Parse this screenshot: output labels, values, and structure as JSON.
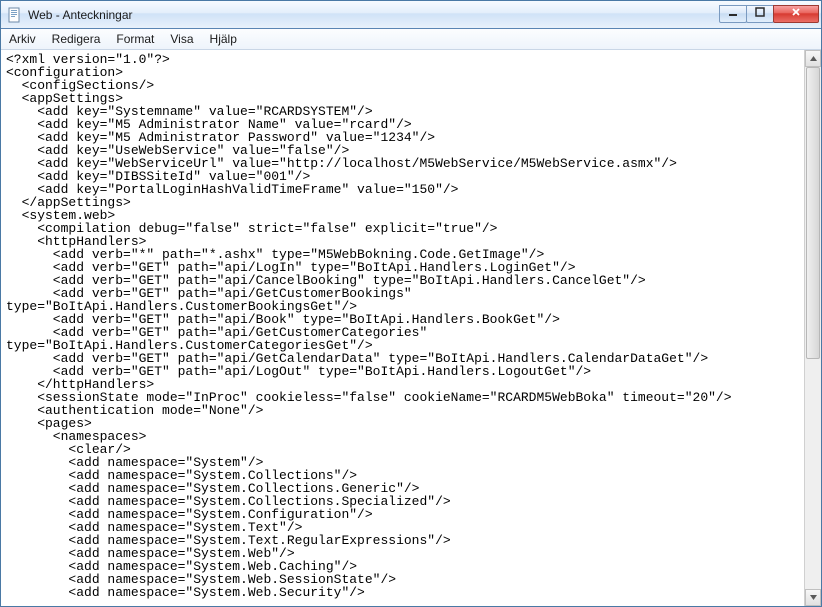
{
  "window": {
    "title": "Web - Anteckningar"
  },
  "menu": {
    "items": [
      "Arkiv",
      "Redigera",
      "Format",
      "Visa",
      "Hjälp"
    ]
  },
  "icons": {
    "app": "notepad-icon",
    "minimize": "minimize-icon",
    "maximize": "maximize-icon",
    "close": "close-icon",
    "scroll_up": "scroll-up-icon",
    "scroll_down": "scroll-down-icon"
  },
  "controls": {
    "minimize": "Minimize",
    "maximize": "Maximize",
    "close": "Close"
  },
  "editor": {
    "content": "<?xml version=\"1.0\"?>\n<configuration>\n  <configSections/>\n  <appSettings>\n    <add key=\"Systemname\" value=\"RCARDSYSTEM\"/>\n    <add key=\"M5 Administrator Name\" value=\"rcard\"/>\n    <add key=\"M5 Administrator Password\" value=\"1234\"/>\n    <add key=\"UseWebService\" value=\"false\"/>\n    <add key=\"WebServiceUrl\" value=\"http://localhost/M5WebService/M5WebService.asmx\"/>\n    <add key=\"DIBSSiteId\" value=\"001\"/>\n    <add key=\"PortalLoginHashValidTimeFrame\" value=\"150\"/>\n  </appSettings>\n  <system.web>\n    <compilation debug=\"false\" strict=\"false\" explicit=\"true\"/>\n    <httpHandlers>\n      <add verb=\"*\" path=\"*.ashx\" type=\"M5WebBokning.Code.GetImage\"/>\n      <add verb=\"GET\" path=\"api/LogIn\" type=\"BoItApi.Handlers.LoginGet\"/>\n      <add verb=\"GET\" path=\"api/CancelBooking\" type=\"BoItApi.Handlers.CancelGet\"/>\n      <add verb=\"GET\" path=\"api/GetCustomerBookings\" \ntype=\"BoItApi.Handlers.CustomerBookingsGet\"/>\n      <add verb=\"GET\" path=\"api/Book\" type=\"BoItApi.Handlers.BookGet\"/>\n      <add verb=\"GET\" path=\"api/GetCustomerCategories\" \ntype=\"BoItApi.Handlers.CustomerCategoriesGet\"/>\n      <add verb=\"GET\" path=\"api/GetCalendarData\" type=\"BoItApi.Handlers.CalendarDataGet\"/>\n      <add verb=\"GET\" path=\"api/LogOut\" type=\"BoItApi.Handlers.LogoutGet\"/>\n    </httpHandlers>\n    <sessionState mode=\"InProc\" cookieless=\"false\" cookieName=\"RCARDM5WebBoka\" timeout=\"20\"/>\n    <authentication mode=\"None\"/>\n    <pages>\n      <namespaces>\n        <clear/>\n        <add namespace=\"System\"/>\n        <add namespace=\"System.Collections\"/>\n        <add namespace=\"System.Collections.Generic\"/>\n        <add namespace=\"System.Collections.Specialized\"/>\n        <add namespace=\"System.Configuration\"/>\n        <add namespace=\"System.Text\"/>\n        <add namespace=\"System.Text.RegularExpressions\"/>\n        <add namespace=\"System.Web\"/>\n        <add namespace=\"System.Web.Caching\"/>\n        <add namespace=\"System.Web.SessionState\"/>\n        <add namespace=\"System.Web.Security\"/>"
  }
}
